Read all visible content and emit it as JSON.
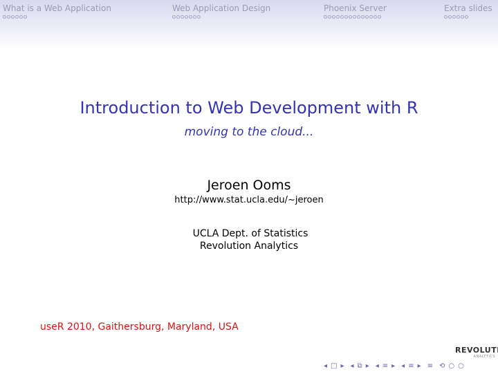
{
  "nav": {
    "sections": [
      {
        "label": "What is a Web Application",
        "dots": 6
      },
      {
        "label": "Web Application Design",
        "dots": 7
      },
      {
        "label": "Phoenix Server",
        "dots": 14
      },
      {
        "label": "Extra slides",
        "dots": 6
      }
    ]
  },
  "slide": {
    "title": "Introduction to Web Development with R",
    "subtitle": "moving to the cloud...",
    "author": "Jeroen  Ooms",
    "url": "http://www.stat.ucla.edu/~jeroen",
    "affiliation1": "UCLA Dept. of Statistics",
    "affiliation2": "Revolution Analytics",
    "footer": "useR 2010, Gaithersburg, Maryland, USA"
  },
  "logo": {
    "name": "REVOLUTION",
    "sub": "ANALYTICS"
  },
  "colors": {
    "title": "#3333b3",
    "footer": "#dd1111",
    "nav_text": "#9a9ab8"
  }
}
